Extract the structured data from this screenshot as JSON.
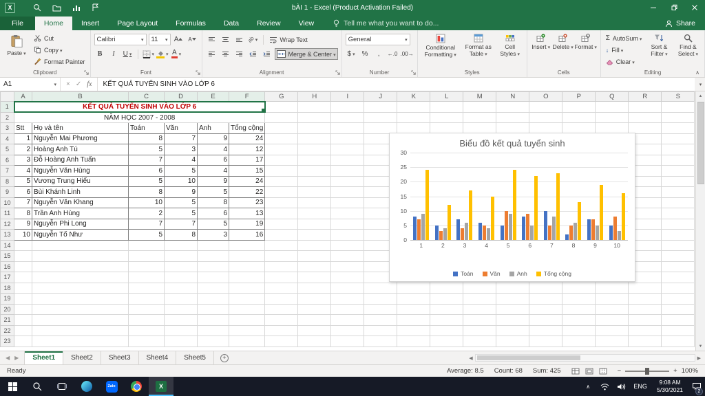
{
  "colors": {
    "excel_green": "#217346",
    "title_red": "#c00000",
    "series_colors": [
      "#4472c4",
      "#ed7d31",
      "#a5a5a5",
      "#ffc000"
    ]
  },
  "icons": {
    "dropdown": "▾",
    "check": "✓",
    "cancel": "×",
    "sigma": "Σ",
    "fill_arrow": "↓",
    "chevron_up": "∧",
    "prev_tri": "◀",
    "next_tri": "▶",
    "up_tri": "▲",
    "down_tri": "▼",
    "plus": "+",
    "minus": "−",
    "bold": "B",
    "italic": "I",
    "underline": "U",
    "currency": "$",
    "percent": "%",
    "comma": ",",
    "inc_decimal": "←.0",
    "dec_decimal": ".00→",
    "letter_a": "A",
    "orientation": "ab"
  },
  "titlebar": {
    "title": "bÀI 1 - Excel (Product Activation Failed)"
  },
  "ribbon_tabs": {
    "file": "File",
    "items": [
      "Home",
      "Insert",
      "Page Layout",
      "Formulas",
      "Data",
      "Review",
      "View"
    ],
    "tell_me": "Tell me what you want to do...",
    "share": "Share"
  },
  "ribbon": {
    "clipboard": {
      "label": "Clipboard",
      "paste": "Paste",
      "cut": "Cut",
      "copy": "Copy",
      "format_painter": "Format Painter"
    },
    "font": {
      "label": "Font",
      "family": "Calibri",
      "size": "11"
    },
    "alignment": {
      "label": "Alignment",
      "wrap_text": "Wrap Text",
      "merge_center": "Merge & Center"
    },
    "number": {
      "label": "Number",
      "format": "General"
    },
    "styles": {
      "label": "Styles",
      "conditional": "Conditional Formatting",
      "format_table": "Format as Table",
      "cell_styles": "Cell Styles"
    },
    "cells": {
      "label": "Cells",
      "insert": "Insert",
      "delete": "Delete",
      "format": "Format"
    },
    "editing": {
      "label": "Editing",
      "autosum": "AutoSum",
      "fill": "Fill",
      "clear": "Clear",
      "sort": "Sort & Filter",
      "find": "Find & Select"
    }
  },
  "formula_bar": {
    "name_box": "A1",
    "fx": "fx",
    "content": "KẾT QUẢ TUYỂN SINH VÀO LỚP 6"
  },
  "sheet": {
    "columns": [
      "A",
      "B",
      "C",
      "D",
      "E",
      "F",
      "G",
      "H",
      "I",
      "J",
      "K",
      "L",
      "M",
      "N",
      "O",
      "P",
      "Q",
      "R",
      "S"
    ],
    "rows_visible": 23,
    "title": "KẾT QUẢ TUYỂN SINH VÀO LỚP 6",
    "subtitle": "NĂM HỌC 2007 - 2008",
    "table_headers": [
      "Stt",
      "Họ và tên",
      "Toán",
      "Văn",
      "Anh",
      "Tổng cộng"
    ],
    "records": [
      [
        1,
        "Nguyễn Mai Phương",
        8,
        7,
        9,
        24
      ],
      [
        2,
        "Hoàng Anh Tú",
        5,
        3,
        4,
        12
      ],
      [
        3,
        "Đỗ Hoàng Anh Tuấn",
        7,
        4,
        6,
        17
      ],
      [
        4,
        "Nguyễn Văn Hùng",
        6,
        5,
        4,
        15
      ],
      [
        5,
        "Vương Trung Hiếu",
        5,
        10,
        9,
        24
      ],
      [
        6,
        "Bùi Khánh Linh",
        8,
        9,
        5,
        22
      ],
      [
        7,
        "Nguyễn Văn Khang",
        10,
        5,
        8,
        23
      ],
      [
        8,
        "Trần Anh Hùng",
        2,
        5,
        6,
        13
      ],
      [
        9,
        "Nguyễn Phi Long",
        7,
        7,
        5,
        19
      ],
      [
        10,
        "Nguyễn Tố Như",
        5,
        8,
        3,
        16
      ]
    ]
  },
  "chart_data": {
    "type": "bar",
    "title": "Biểu đồ kết quả tuyển sinh",
    "categories": [
      "1",
      "2",
      "3",
      "4",
      "5",
      "6",
      "7",
      "8",
      "9",
      "10"
    ],
    "series": [
      {
        "name": "Toán",
        "color": "#4472c4",
        "values": [
          8,
          5,
          7,
          6,
          5,
          8,
          10,
          2,
          7,
          5
        ]
      },
      {
        "name": "Văn",
        "color": "#ed7d31",
        "values": [
          7,
          3,
          4,
          5,
          10,
          9,
          5,
          5,
          7,
          8
        ]
      },
      {
        "name": "Anh",
        "color": "#a5a5a5",
        "values": [
          9,
          4,
          6,
          4,
          9,
          5,
          8,
          6,
          5,
          3
        ]
      },
      {
        "name": "Tổng cộng",
        "color": "#ffc000",
        "values": [
          24,
          12,
          17,
          15,
          24,
          22,
          23,
          13,
          19,
          16
        ]
      }
    ],
    "xlabel": "",
    "ylabel": "",
    "ylim": [
      0,
      30
    ],
    "yticks": [
      0,
      5,
      10,
      15,
      20,
      25,
      30
    ],
    "grid": true,
    "legend_position": "bottom"
  },
  "sheet_tabs": {
    "tabs": [
      "Sheet1",
      "Sheet2",
      "Sheet3",
      "Sheet4",
      "Sheet5"
    ],
    "active": "Sheet1"
  },
  "status_bar": {
    "mode": "Ready",
    "average": "Average: 8.5",
    "count": "Count: 68",
    "sum": "Sum: 425",
    "zoom": "100%"
  },
  "taskbar": {
    "lang": "ENG",
    "time": "9:08 AM",
    "date": "5/30/2021",
    "badge": "2"
  }
}
